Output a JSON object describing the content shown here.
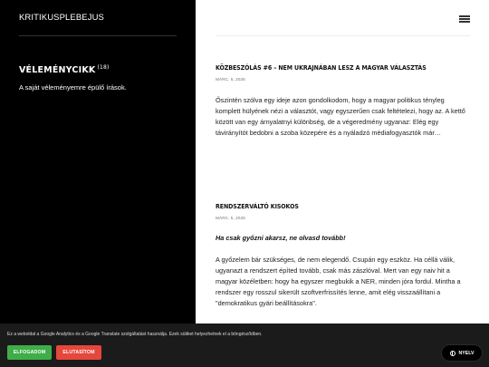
{
  "sidebar": {
    "site_title": "KRITIKUSPLEBEJUS",
    "category_title": "VÉLEMÉNYCIKK",
    "category_count": "(18)",
    "category_description": "A saját véleményemre épülő írások."
  },
  "posts": [
    {
      "title": "Közbeszólás #6 – Nem Ukrajnában lesz a magyar választás",
      "date": "márc. 6, 2026",
      "excerpt": "Őszintén szólva egy ideje azon gondolkodom, hogy a magyar politikus tényleg komplett hülyének nézi a választót, vagy egyszerűen csak feltételezi, hogy az. A kettő között van egy árnyalatnyi különbség, de a végeredmény ugyanaz: Elég egy távirányítót bedobni a szoba közepére és a nyáladzó médiafogyasztók már…"
    },
    {
      "title": "Rendszerváltó kisokos",
      "date": "márc. 5, 2026",
      "lead": "Ha csak győzni akarsz, ne olvasd tovább!",
      "excerpt": "A győzelem bár szükséges, de nem elegendő. Csupán egy eszköz. Ha céllá válik, ugyanazt a rendszert építed tovább, csak más zászlóval. Mert van egy naiv hit a magyar közéletben: hogy ha egyszer megbukik a NER, minden jóra fordul. Mintha a rendszer egy rosszul sikerült szoftverfrissítés lenne, amit elég visszaállítani a \"demokratikus gyári beállításokra\"."
    }
  ],
  "cookie_banner": {
    "text": "Ez a weboldal a Google Analytics és a Google Translate szolgáltatást használja. Ezek sütiket helyezhetnek el a böngésződben.",
    "accept_label": "ELFOGADOM",
    "reject_label": "ELUTASÍTOM",
    "language_label": "NYELV"
  },
  "colors": {
    "sidebar_bg": "#000000",
    "accept": "#3fae49",
    "reject": "#e5473c",
    "cookie_bg": "#1b1b1b"
  },
  "icons": {
    "menu": "hamburger-menu-icon",
    "language": "globe-icon"
  }
}
